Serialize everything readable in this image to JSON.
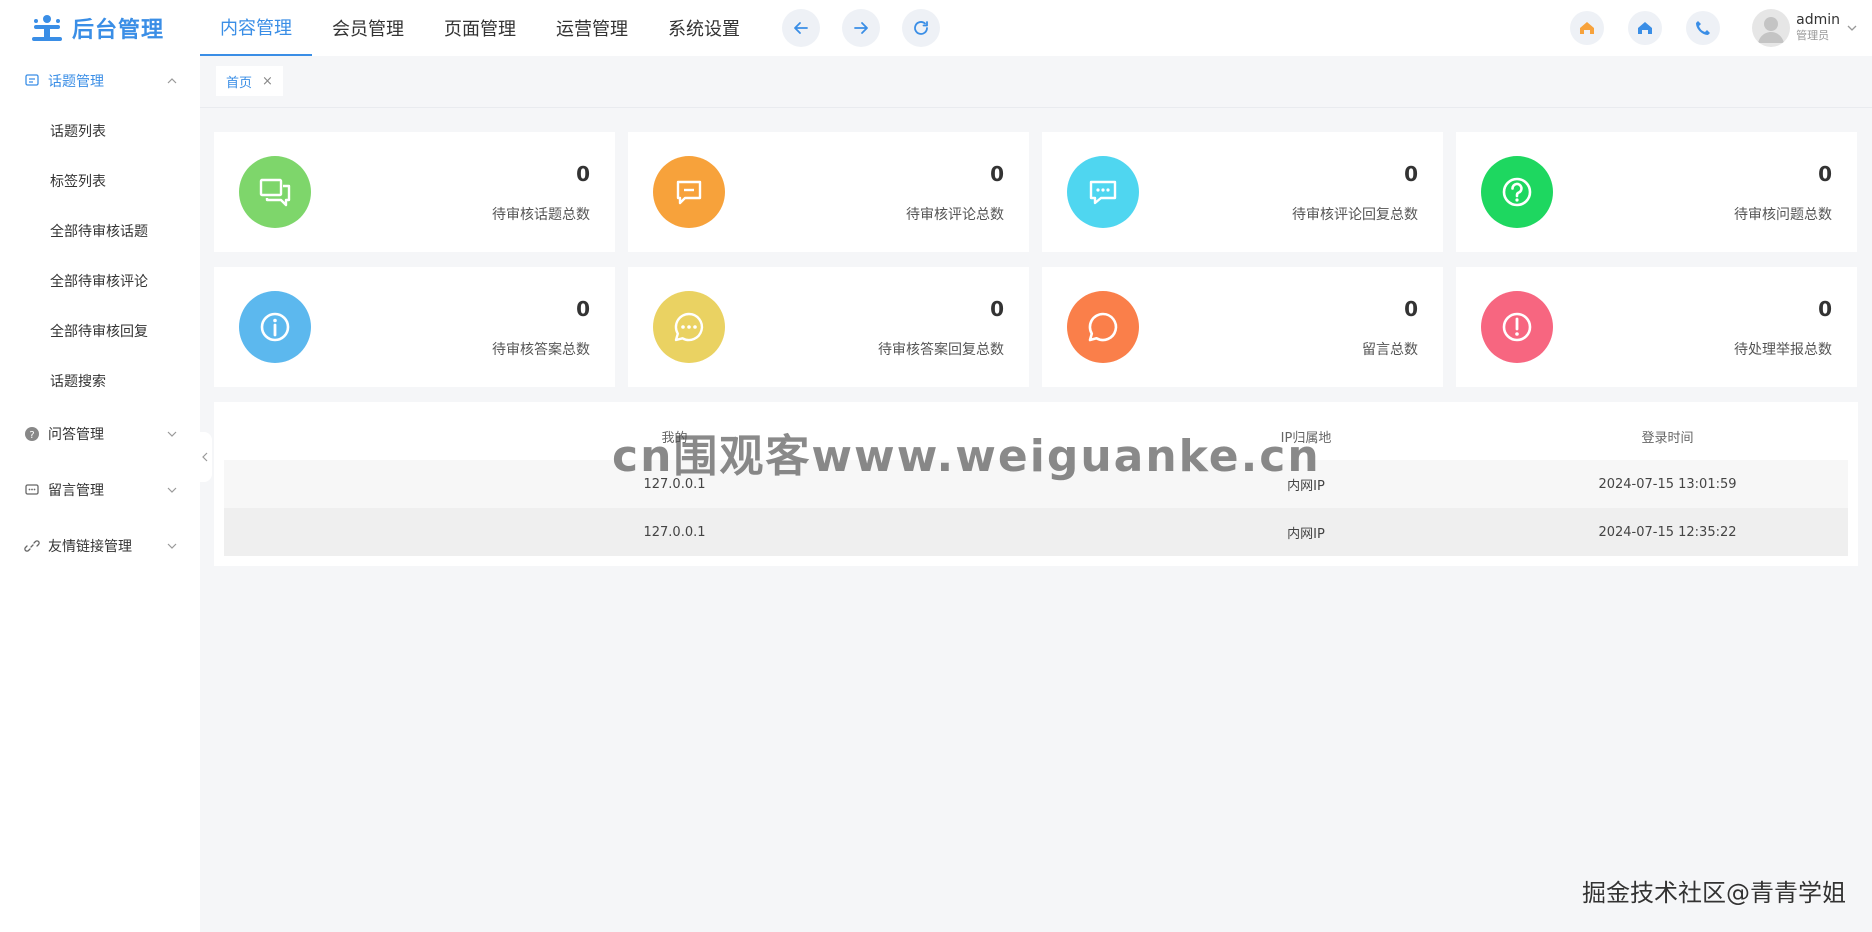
{
  "app": {
    "logo_text": "后台管理"
  },
  "topnav": [
    {
      "label": "内容管理",
      "active": true
    },
    {
      "label": "会员管理"
    },
    {
      "label": "页面管理"
    },
    {
      "label": "运营管理"
    },
    {
      "label": "系统设置"
    }
  ],
  "user": {
    "name": "admin",
    "role": "管理员"
  },
  "sidebar": {
    "groups": [
      {
        "label": "话题管理",
        "open": true,
        "items": [
          "话题列表",
          "标签列表",
          "全部待审核话题",
          "全部待审核评论",
          "全部待审核回复",
          "话题搜索"
        ]
      },
      {
        "label": "问答管理"
      },
      {
        "label": "留言管理"
      },
      {
        "label": "友情链接管理"
      }
    ]
  },
  "tabs": [
    {
      "label": "首页",
      "close": "×"
    }
  ],
  "stats": [
    {
      "value": "0",
      "label": "待审核话题总数",
      "color": "#7ed66b",
      "icon": "chat-bubbles-icon"
    },
    {
      "value": "0",
      "label": "待审核评论总数",
      "color": "#f7a23b",
      "icon": "comment-box-icon"
    },
    {
      "value": "0",
      "label": "待审核评论回复总数",
      "color": "#4fd6f0",
      "icon": "message-dots-icon"
    },
    {
      "value": "0",
      "label": "待审核问题总数",
      "color": "#1ed760",
      "icon": "question-icon"
    },
    {
      "value": "0",
      "label": "待审核答案总数",
      "color": "#5cb8ee",
      "icon": "info-icon"
    },
    {
      "value": "0",
      "label": "待审核答案回复总数",
      "color": "#ead262",
      "icon": "ellipsis-bubble-icon"
    },
    {
      "value": "0",
      "label": "留言总数",
      "color": "#fa7f4a",
      "icon": "speech-bubble-icon"
    },
    {
      "value": "0",
      "label": "待处理举报总数",
      "color": "#f76680",
      "icon": "alert-icon"
    }
  ],
  "login_table": {
    "headers": [
      "我的",
      "IP归属地",
      "登录时间"
    ],
    "rows": [
      [
        "127.0.0.1",
        "内网IP",
        "2024-07-15 13:01:59"
      ],
      [
        "127.0.0.1",
        "内网IP",
        "2024-07-15 12:35:22"
      ]
    ]
  },
  "watermarks": {
    "center": "cn围观客www.weiguanke.cn",
    "corner": "掘金技术社区@青青学姐"
  }
}
